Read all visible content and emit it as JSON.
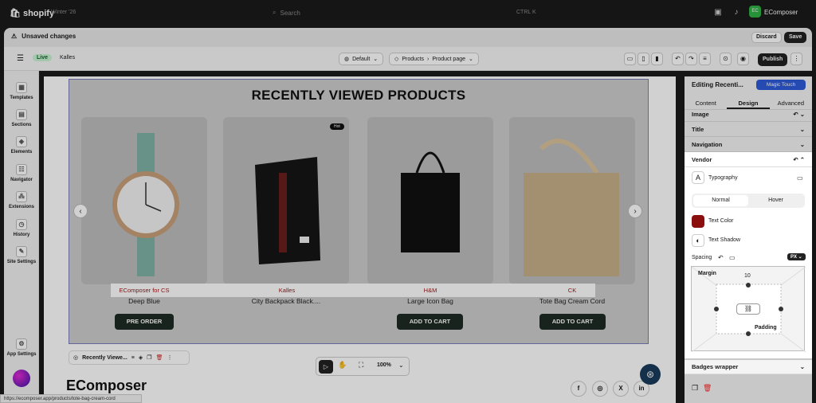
{
  "topbar": {
    "brand": "shopify",
    "store": "Winter '26",
    "search_placeholder": "Search",
    "shortcut": "CTRL K",
    "account": "EComposer",
    "account_badge": "EC"
  },
  "unsaved": {
    "title": "Unsaved changes",
    "discard": "Discard",
    "save": "Save"
  },
  "toolbar": {
    "status": "Live",
    "theme": "Kalles",
    "default": "Default",
    "page_crumb_1": "Products",
    "page_crumb_2": "Product page",
    "publish": "Publish"
  },
  "sidebar": {
    "items": [
      "Templates",
      "Sections",
      "Elements",
      "Navigator",
      "Extensions",
      "History",
      "Site Settings"
    ],
    "app_settings": "App Settings"
  },
  "canvas": {
    "section_title": "RECENTLY VIEWED PRODUCTS",
    "hot_badge": "Hot",
    "products": [
      {
        "vendor": "EComposer for CS",
        "name": "Deep Blue",
        "button": "PRE ORDER"
      },
      {
        "vendor": "Kalles",
        "name": "City Backpack Black....",
        "button": ""
      },
      {
        "vendor": "H&M",
        "name": "Large Icon Bag",
        "button": "ADD TO CART"
      },
      {
        "vendor": "CK",
        "name": "Tote Bag Cream Cord",
        "button": "ADD TO CART"
      }
    ],
    "selected_label": "Recently Viewe...",
    "zoom": "100%",
    "footer_logo": "EComposer",
    "social": [
      "f",
      "◎",
      "X",
      "in"
    ]
  },
  "status_url": "https://ecomposer.app/products/tote-bag-cream-cord",
  "panel": {
    "title": "Editing Recenti...",
    "magic": "Magic Touch",
    "tabs": [
      "Content",
      "Design",
      "Advanced"
    ],
    "rows": [
      "Image",
      "Title",
      "Navigation"
    ],
    "vendor": "Vendor",
    "typography": "Typography",
    "normal": "Normal",
    "hover": "Hover",
    "text_color": "Text Color",
    "text_color_value": "#8b0e0e",
    "text_shadow": "Text Shadow",
    "spacing": "Spacing",
    "unit": "PX",
    "margin": "Margin",
    "margin_top": "10",
    "padding": "Padding",
    "badges": "Badges wrapper"
  }
}
